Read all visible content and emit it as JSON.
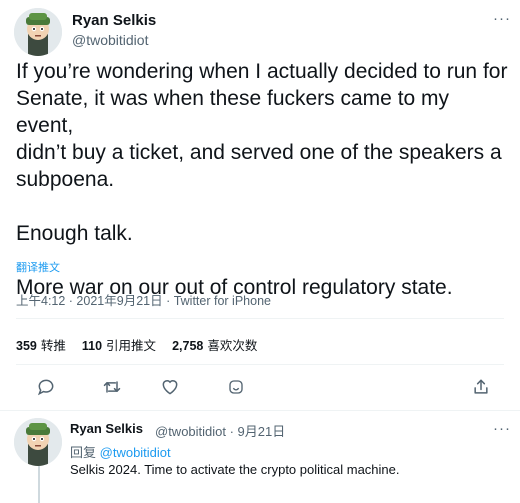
{
  "tweet": {
    "author_name": "Ryan Selkis",
    "author_handle": "@twobitidiot",
    "text": "If you’re wondering when I actually decided to run for\nSenate, it was when these fuckers came to my event,\ndidn’t buy a ticket, and served one of the speakers a\nsubpoena.\n\nEnough talk.\n\nMore war on our out of control regulatory state.",
    "translate_label": "翻译推文",
    "timestamp": "上午4:12 · 2021年9月21日 · Twitter for iPhone",
    "more_label": "···"
  },
  "stats": [
    {
      "count": "359",
      "label": "转推"
    },
    {
      "count": "110",
      "label": "引用推文"
    },
    {
      "count": "2,758",
      "label": "喜欢次数"
    }
  ],
  "actions": [
    "reply-icon",
    "retweet-icon",
    "like-icon",
    "react-icon",
    "share-icon"
  ],
  "reply": {
    "author_name": "Ryan Selkis",
    "author_handle_date": "@twobitidiot · 9月21日",
    "replying_prefix": "回复",
    "replying_to": "@twobitidiot",
    "text": "Selkis 2024. Time to activate the crypto political machine.",
    "more_label": "···"
  },
  "colors": {
    "accent": "#1d9bf0",
    "secondary_text": "#536471",
    "divider": "#eff3f4"
  }
}
